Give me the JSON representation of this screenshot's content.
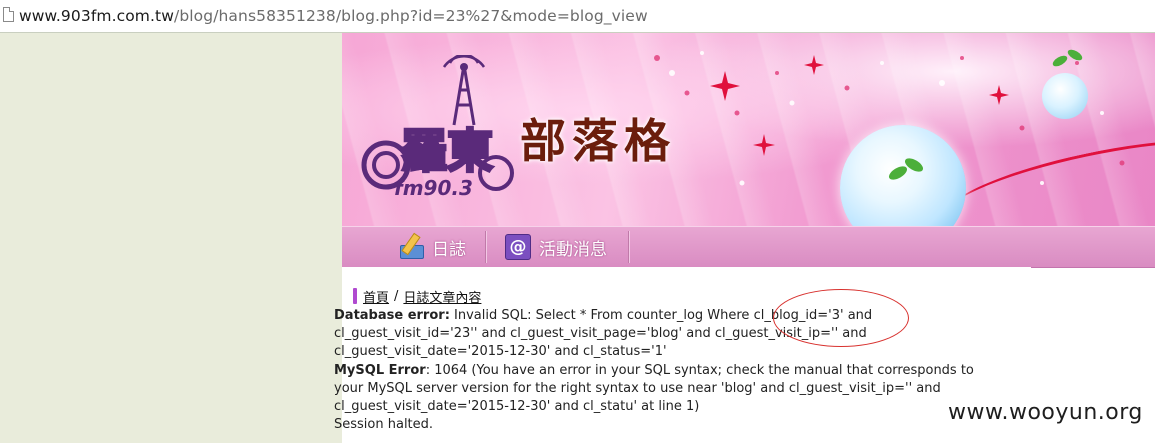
{
  "browser": {
    "url_host": "www.903fm.com.tw",
    "url_path": "/blog/hans58351238/blog.php?id=23%27&mode=blog_view"
  },
  "banner": {
    "logo_text": "部落格",
    "brand_text": "羅東",
    "brand_freq": "fm90.3"
  },
  "nav": {
    "items": [
      {
        "label": "日誌",
        "icon": "pencil-notebook-icon"
      },
      {
        "label": "活動消息",
        "icon": "at-sign-icon"
      }
    ]
  },
  "breadcrumb": {
    "home": "首頁",
    "separator": "/",
    "current": "日誌文章內容"
  },
  "errors": {
    "db_label": "Database error:",
    "db_line1": " Invalid SQL: Select * From counter_log Where cl_blog_id='3' and",
    "db_line2": "cl_guest_visit_id='23'' and cl_guest_visit_page='blog' and cl_guest_visit_ip='' and",
    "db_line3": "cl_guest_visit_date='2015-12-30' and cl_status='1'",
    "mysql_label": "MySQL Error",
    "mysql_line1": ": 1064 (You have an error in your SQL syntax; check the manual that corresponds to",
    "mysql_line2": "your MySQL server version for the right syntax to use near 'blog' and cl_guest_visit_ip='' and",
    "mysql_line3": "cl_guest_visit_date='2015-12-30' and cl_statu' at line 1)",
    "halted": "Session halted."
  },
  "watermark": "www.wooyun.org",
  "colors": {
    "banner_pink": "#f6a6d5",
    "nav_pink": "#e8a6d2",
    "logo_brown": "#6b1d0c",
    "annotation_red": "#d8322f"
  }
}
